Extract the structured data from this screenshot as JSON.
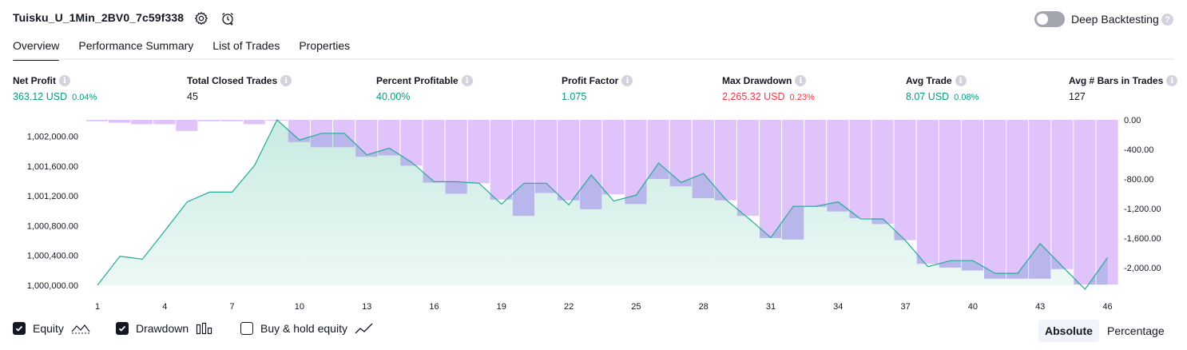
{
  "header": {
    "strategy_name": "Tuisku_U_1Min_2BV0_7c59f338",
    "deep_backtesting_label": "Deep Backtesting",
    "deep_backtesting_enabled": false
  },
  "tabs": [
    {
      "label": "Overview",
      "active": true
    },
    {
      "label": "Performance Summary",
      "active": false
    },
    {
      "label": "List of Trades",
      "active": false
    },
    {
      "label": "Properties",
      "active": false
    }
  ],
  "metrics": [
    {
      "label": "Net Profit",
      "value": "363.12 USD",
      "sub": "0.04%",
      "tone": "pos"
    },
    {
      "label": "Total Closed Trades",
      "value": "45",
      "sub": "",
      "tone": "neutral"
    },
    {
      "label": "Percent Profitable",
      "value": "40.00%",
      "sub": "",
      "tone": "pos"
    },
    {
      "label": "Profit Factor",
      "value": "1.075",
      "sub": "",
      "tone": "pos"
    },
    {
      "label": "Max Drawdown",
      "value": "2,265.32 USD",
      "sub": "0.23%",
      "tone": "neg"
    },
    {
      "label": "Avg Trade",
      "value": "8.07 USD",
      "sub": "0.08%",
      "tone": "pos"
    },
    {
      "label": "Avg # Bars in Trades",
      "value": "127",
      "sub": "",
      "tone": "neutral"
    }
  ],
  "legend": {
    "equity_label": "Equity",
    "equity_checked": true,
    "drawdown_label": "Drawdown",
    "drawdown_checked": true,
    "buyhold_label": "Buy & hold equity",
    "buyhold_checked": false
  },
  "view_modes": {
    "absolute_label": "Absolute",
    "percentage_label": "Percentage",
    "selected": "Absolute"
  },
  "colors": {
    "equity_line": "#22ab94",
    "equity_fill_top": "#c8ebe1",
    "equity_fill_bottom": "#eef9f6",
    "drawdown_fill": "#e1c3fc",
    "overlap_fill": "#b9b6ec",
    "positive": "#089981",
    "negative": "#f23645"
  },
  "chart_data": {
    "type": "area",
    "x": [
      1,
      2,
      3,
      4,
      5,
      6,
      7,
      8,
      9,
      10,
      11,
      12,
      13,
      14,
      15,
      16,
      17,
      18,
      19,
      20,
      21,
      22,
      23,
      24,
      25,
      26,
      27,
      28,
      29,
      30,
      31,
      32,
      33,
      34,
      35,
      36,
      37,
      38,
      39,
      40,
      41,
      42,
      43,
      44,
      45,
      46
    ],
    "x_tick_labels": [
      "1",
      "4",
      "7",
      "10",
      "13",
      "16",
      "19",
      "22",
      "25",
      "28",
      "31",
      "34",
      "37",
      "40",
      "43",
      "46"
    ],
    "y_left_tick_labels": [
      "1,000,000.00",
      "1,000,400.00",
      "1,000,800.00",
      "1,001,200.00",
      "1,001,600.00",
      "1,002,000.00"
    ],
    "y_left_ticks": [
      1000000,
      1000400,
      1000800,
      1001200,
      1001600,
      1002000
    ],
    "y_left_range": [
      1000000,
      1002220
    ],
    "y_right_tick_labels": [
      "0.00",
      "-400.00",
      "-800.00",
      "-1,200.00",
      "-1,600.00",
      "-2,000.00"
    ],
    "y_right_ticks": [
      0,
      -400,
      -800,
      -1200,
      -1600,
      -2000
    ],
    "y_right_range": [
      -2240,
      0
    ],
    "series": [
      {
        "name": "Equity",
        "values": [
          1000000,
          1000390,
          1000350,
          1000730,
          1001120,
          1001250,
          1001250,
          1001610,
          1002220,
          1001950,
          1002040,
          1002040,
          1001750,
          1001840,
          1001650,
          1001390,
          1001390,
          1001370,
          1001090,
          1001370,
          1001370,
          1001080,
          1001480,
          1001130,
          1001210,
          1001640,
          1001380,
          1001500,
          1001150,
          1000900,
          1000640,
          1001060,
          1001060,
          1001120,
          1000890,
          1000890,
          1000600,
          1000250,
          1000330,
          1000330,
          1000160,
          1000160,
          1000560,
          1000250,
          0,
          1000370
        ]
      },
      {
        "name": "Drawdown",
        "values": [
          -20,
          -40,
          -60,
          -60,
          -150,
          -20,
          -20,
          -60,
          -10,
          -300,
          -370,
          -370,
          -500,
          -480,
          -620,
          -850,
          -1000,
          -860,
          -1080,
          -1300,
          -990,
          -1090,
          -1210,
          -1010,
          -1140,
          -800,
          -900,
          -1060,
          -1090,
          -1300,
          -1600,
          -1620,
          -1180,
          -1240,
          -1330,
          -1410,
          -1630,
          -1950,
          -2000,
          -2040,
          -2150,
          -2150,
          -2150,
          -2020,
          -2230,
          -2230
        ]
      }
    ]
  }
}
